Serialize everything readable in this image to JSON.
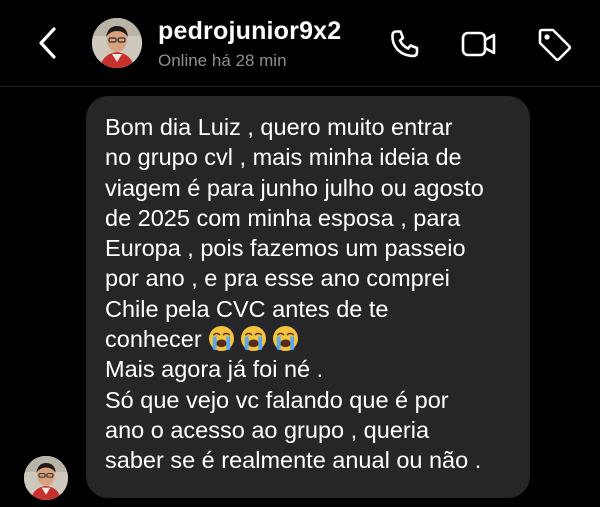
{
  "header": {
    "username": "pedrojunior9x2",
    "status": "Online há 28 min",
    "icons": [
      "back-chevron-icon",
      "phone-icon",
      "video-camera-icon",
      "tag-icon"
    ]
  },
  "message": {
    "lines": [
      "Bom dia Luiz , quero muito entrar",
      "no grupo cvl , mais minha ideia de",
      "viagem é para junho julho ou agosto",
      "de 2025 com minha esposa , para",
      "Europa , pois fazemos um passeio",
      "por ano , e pra esse ano comprei",
      "Chile pela CVC antes de te",
      "conhecer",
      "Mais agora já foi né .",
      "Só que vejo vc falando que é por",
      "ano o acesso ao grupo , queria",
      "saber se é realmente anual ou não ."
    ],
    "emojis": [
      "crying-face-emoji",
      "crying-face-emoji",
      "crying-face-emoji"
    ]
  },
  "colors": {
    "background": "#000000",
    "bubble": "#262628",
    "status_text": "#8e8e93"
  }
}
